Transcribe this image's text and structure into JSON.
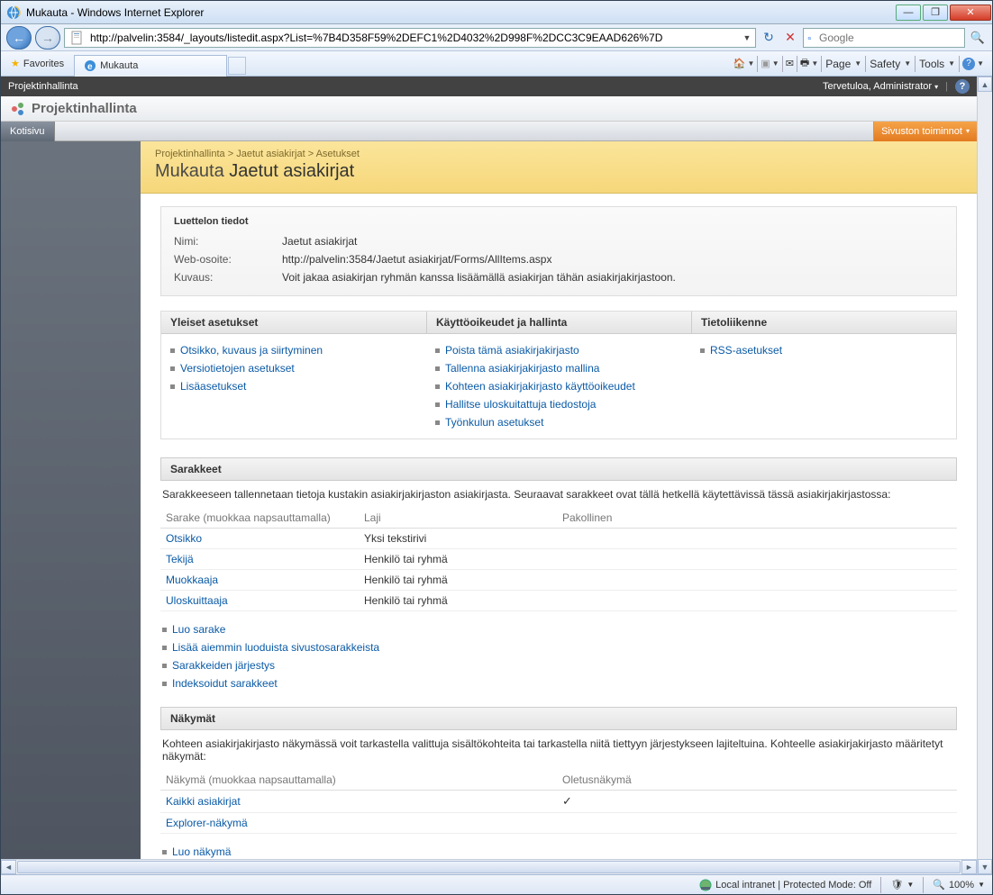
{
  "window": {
    "title": "Mukauta - Windows Internet Explorer"
  },
  "address": "http://palvelin:3584/_layouts/listedit.aspx?List=%7B4D358F59%2DEFC1%2D4032%2D998F%2DCC3C9EAAD626%7D",
  "search": {
    "placeholder": "Google"
  },
  "favrow": {
    "favorites": "Favorites",
    "tab_title": "Mukauta"
  },
  "cmdbar": {
    "page": "Page",
    "safety": "Safety",
    "tools": "Tools"
  },
  "sp_top": {
    "site": "Projektinhallinta",
    "welcome": "Tervetuloa, Administrator"
  },
  "sp_header": {
    "site": "Projektinhallinta"
  },
  "sp_nav": {
    "home": "Kotisivu",
    "site_actions": "Sivuston toiminnot"
  },
  "breadcrumb": {
    "a": "Projektinhallinta",
    "b": "Jaetut asiakirjat",
    "c": "Asetukset",
    "sep": " > "
  },
  "page_title": {
    "pre": "Mukauta ",
    "main": "Jaetut asiakirjat"
  },
  "info": {
    "heading": "Luettelon tiedot",
    "name_label": "Nimi:",
    "name_val": "Jaetut asiakirjat",
    "url_label": "Web-osoite:",
    "url_val": "http://palvelin:3584/Jaetut asiakirjat/Forms/AllItems.aspx",
    "desc_label": "Kuvaus:",
    "desc_val": "Voit jakaa asiakirjan ryhmän kanssa lisäämällä asiakirjan tähän asiakirjakirjastoon."
  },
  "cols3": {
    "general": {
      "head": "Yleiset asetukset",
      "links": [
        "Otsikko, kuvaus ja siirtyminen",
        "Versiotietojen asetukset",
        "Lisäasetukset"
      ]
    },
    "perms": {
      "head": "Käyttöoikeudet ja hallinta",
      "links": [
        "Poista tämä asiakirjakirjasto",
        "Tallenna asiakirjakirjasto mallina",
        "Kohteen asiakirjakirjasto käyttöoikeudet",
        "Hallitse uloskuitattuja tiedostoja",
        "Työnkulun asetukset"
      ]
    },
    "comm": {
      "head": "Tietoliikenne",
      "links": [
        "RSS-asetukset"
      ]
    }
  },
  "columns": {
    "head": "Sarakkeet",
    "desc": "Sarakkeeseen tallennetaan tietoja kustakin asiakirjakirjaston asiakirjasta. Seuraavat sarakkeet ovat tällä hetkellä käytettävissä tässä asiakirjakirjastossa:",
    "th1": "Sarake (muokkaa napsauttamalla)",
    "th2": "Laji",
    "th3": "Pakollinen",
    "rows": [
      {
        "name": "Otsikko",
        "type": "Yksi tekstirivi",
        "req": ""
      },
      {
        "name": "Tekijä",
        "type": "Henkilö tai ryhmä",
        "req": ""
      },
      {
        "name": "Muokkaaja",
        "type": "Henkilö tai ryhmä",
        "req": ""
      },
      {
        "name": "Uloskuittaaja",
        "type": "Henkilö tai ryhmä",
        "req": ""
      }
    ],
    "actions": [
      "Luo sarake",
      "Lisää aiemmin luoduista sivustosarakkeista",
      "Sarakkeiden järjestys",
      "Indeksoidut sarakkeet"
    ]
  },
  "views": {
    "head": "Näkymät",
    "desc": "Kohteen asiakirjakirjasto näkymässä voit tarkastella valittuja sisältökohteita tai tarkastella niitä tiettyyn järjestykseen lajiteltuina. Kohteelle asiakirjakirjasto määritetyt näkymät:",
    "th1": "Näkymä (muokkaa napsauttamalla)",
    "th2": "Oletusnäkymä",
    "rows": [
      {
        "name": "Kaikki asiakirjat",
        "def": "✓"
      },
      {
        "name": "Explorer-näkymä",
        "def": ""
      }
    ],
    "actions": [
      "Luo näkymä"
    ]
  },
  "status": {
    "zone": "Local intranet | Protected Mode: Off",
    "zoom": "100%"
  }
}
